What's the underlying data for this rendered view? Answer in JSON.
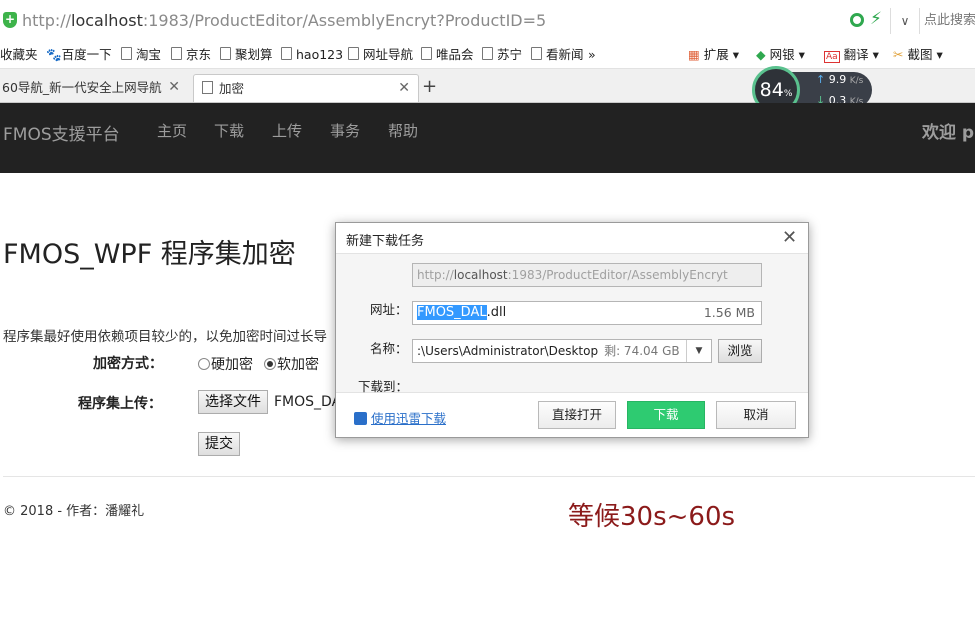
{
  "browser": {
    "url_prefix": "http://",
    "url_host": "localhost",
    "url_rest": ":1983/ProductEditor/AssemblyEncryt?ProductID=5",
    "search_placeholder": "点此搜索",
    "bookmarks": [
      "收藏夹",
      "百度一下",
      "淘宝",
      "京东",
      "聚划算",
      "hao123",
      "网址导航",
      "唯品会",
      "苏宁",
      "看新闻",
      "»"
    ],
    "extensions": [
      "扩展",
      "网银",
      "翻译",
      "截图"
    ],
    "tabs": [
      {
        "label": "60导航_新一代安全上网导航"
      },
      {
        "label": "加密"
      }
    ],
    "new_tab": "+",
    "speed": {
      "percent": "84",
      "percent_unit": "%",
      "up": "9.9",
      "down": "0.3",
      "unit": "K/s"
    }
  },
  "navbar": {
    "brand": "FMOS支援平台",
    "items": [
      "主页",
      "下载",
      "上传",
      "事务",
      "帮助"
    ],
    "welcome": "欢迎 p"
  },
  "page": {
    "title": "FMOS_WPF 程序集加密",
    "description": "程序集最好使用依赖项目较少的，以免加密时间过长导",
    "encrypt_mode_label": "加密方式：",
    "radio_hard": "硬加密",
    "radio_soft": "软加密",
    "upload_label": "程序集上传：",
    "choose_file": "选择文件",
    "chosen_file": "FMOS_DA",
    "submit": "提交",
    "footer": "© 2018 - 作者：潘耀礼",
    "wait_note": "等候30s~60s"
  },
  "dialog": {
    "title": "新建下载任务",
    "close": "✕",
    "url_label": "网址：",
    "url_prefix": "http://",
    "url_host": "localhost",
    "url_rest": ":1983/ProductEditor/AssemblyEncryt",
    "name_label": "名称：",
    "name_selected": "FMOS_DAL",
    "name_ext": ".dll",
    "size": "1.56 MB",
    "save_label": "下载到：",
    "save_path": ":\\Users\\Administrator\\Desktop",
    "free_space": "剩: 74.04 GB",
    "browse": "浏览",
    "thunder_link": "使用迅雷下载",
    "open_button": "直接打开",
    "download_button": "下载",
    "cancel_button": "取消"
  }
}
